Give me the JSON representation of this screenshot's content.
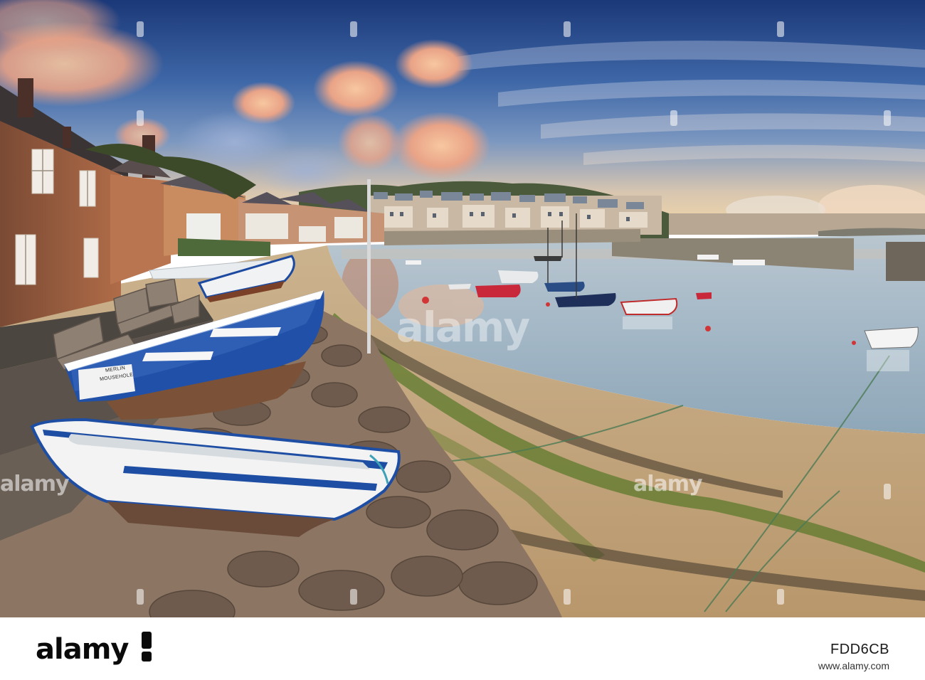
{
  "photo": {
    "subject": "harbour-at-sunrise",
    "colors": {
      "sky_top": "#1e3f80",
      "sky_mid": "#4f79b6",
      "sky_horizon": "#f3d6a4",
      "cloud_glow": "#f3b48d",
      "water": "#9fb7c9",
      "sand": "#cfb28a",
      "stone": "#8a6a55",
      "boat_blue": "#1f4fa8",
      "boat_white": "#f2f2f2",
      "seaweed": "#5b7a2a"
    }
  },
  "boats": {
    "front_label_line1": "MERLIN",
    "front_label_line2": "MOUSEHOLE"
  },
  "watermark": {
    "center_text": "alamy",
    "left_text": "alamy",
    "right_text": "alamy"
  },
  "footer": {
    "logo_text": "alamy",
    "image_id": "FDD6CB",
    "url": "www.alamy.com"
  }
}
